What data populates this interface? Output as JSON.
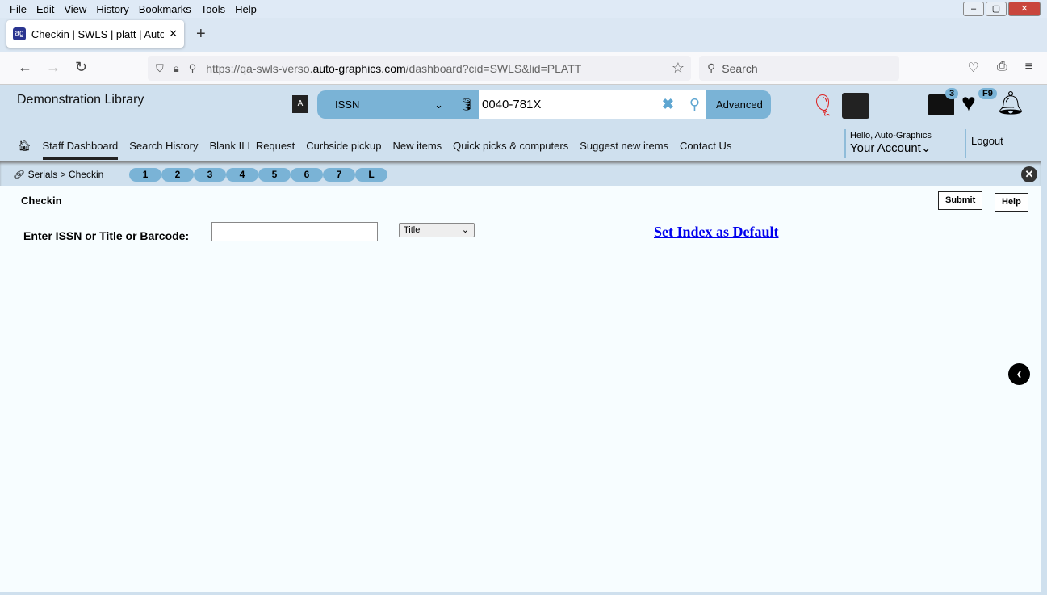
{
  "browser": {
    "menu": [
      "File",
      "Edit",
      "View",
      "History",
      "Bookmarks",
      "Tools",
      "Help"
    ],
    "tab_title": "Checkin | SWLS | platt | Auto-Graphics",
    "url_prefix": "https://qa-swls-verso.",
    "url_domain": "auto-graphics.com",
    "url_path": "/dashboard?cid=SWLS&lid=PLATT",
    "search_placeholder": "Search"
  },
  "header": {
    "library": "Demonstration Library",
    "search_type": "ISSN",
    "search_value": "0040-781X",
    "advanced": "Advanced",
    "list_badge": "3",
    "fav_badge": "F9"
  },
  "nav": {
    "items": [
      "Staff Dashboard",
      "Search History",
      "Blank ILL Request",
      "Curbside pickup",
      "New items",
      "Quick picks & computers",
      "Suggest new items",
      "Contact Us"
    ],
    "hello": "Hello, Auto-Graphics",
    "account": "Your Account",
    "logout": "Logout"
  },
  "breadcrumb": {
    "text": "Serials > Checkin",
    "pills": [
      "1",
      "2",
      "3",
      "4",
      "5",
      "6",
      "7",
      "L"
    ]
  },
  "main": {
    "heading": "Checkin",
    "submit": "Submit",
    "help": "Help",
    "label": "Enter ISSN or Title or Barcode:",
    "input_value": "",
    "index_select": "Title",
    "set_default": "Set Index as Default"
  }
}
